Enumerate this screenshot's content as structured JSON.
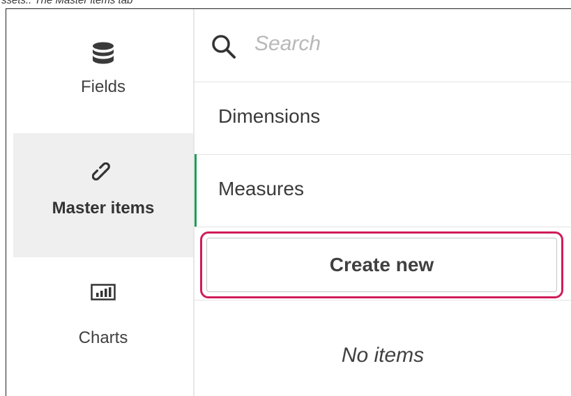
{
  "caption": "ssets.. The Master items tab",
  "sidebar": {
    "items": [
      {
        "label": "Fields",
        "icon": "database-icon",
        "selected": false
      },
      {
        "label": "Master items",
        "icon": "link-icon",
        "selected": true
      },
      {
        "label": "Charts",
        "icon": "bar-chart-icon",
        "selected": false
      }
    ]
  },
  "panel": {
    "search": {
      "placeholder": "Search",
      "icon": "search-icon"
    },
    "sections": [
      {
        "label": "Dimensions",
        "active": false
      },
      {
        "label": "Measures",
        "active": true
      }
    ],
    "create_button_label": "Create new",
    "empty_text": "No items"
  },
  "colors": {
    "selected_bg": "#efefef",
    "active_accent": "#1f9d55",
    "highlight_border": "#d01c58",
    "text": "#404040",
    "placeholder": "#b8b8b8"
  }
}
